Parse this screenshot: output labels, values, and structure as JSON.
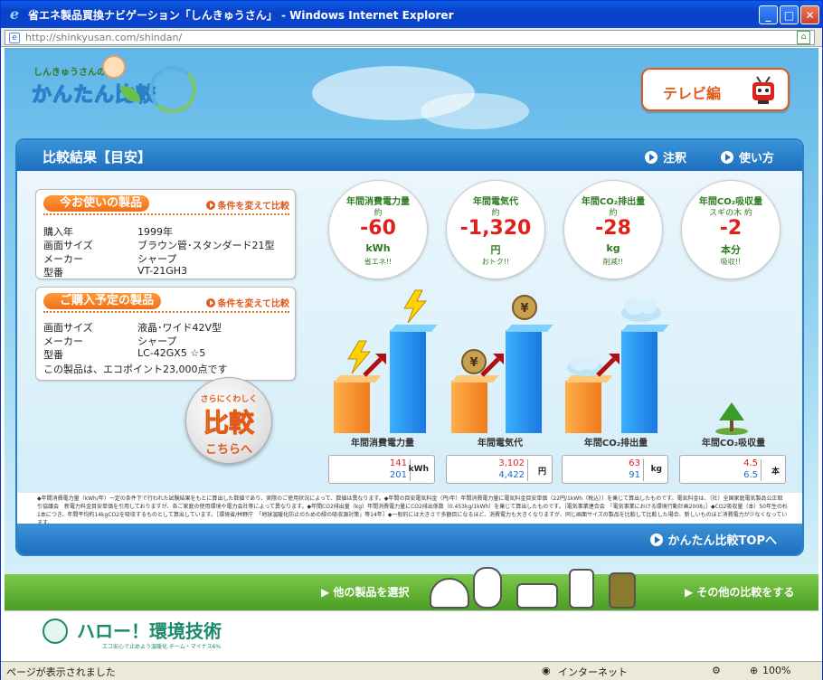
{
  "window": {
    "title": "省エネ製品買換ナビゲーション「しんきゅうさん」 - Windows Internet Explorer",
    "url": "http://shinkyusan.com/shindan/"
  },
  "logo": {
    "small": "しんきゅうさんの",
    "big": "かんたん比較"
  },
  "tv_button": "テレビ編",
  "panel": {
    "title": "比較結果【目安】",
    "links": {
      "notes": "注釈",
      "howto": "使い方"
    },
    "current": {
      "header": "今お使いの製品",
      "change": "条件を変えて比較",
      "rows": [
        {
          "k": "購入年",
          "v": "1999年"
        },
        {
          "k": "画面サイズ",
          "v": "ブラウン管･スタンダード21型"
        },
        {
          "k": "メーカー",
          "v": "シャープ"
        },
        {
          "k": "型番",
          "v": "VT-21GH3"
        }
      ]
    },
    "planned": {
      "header": "ご購入予定の製品",
      "change": "条件を変えて比較",
      "rows": [
        {
          "k": "画面サイズ",
          "v": "液晶･ワイド42V型"
        },
        {
          "k": "メーカー",
          "v": "シャープ"
        },
        {
          "k": "型番",
          "v": "LC-42GX5 ☆5"
        }
      ],
      "eco": "この製品は、エコポイント23,000点です"
    },
    "more": {
      "l1": "さらにくわしく",
      "l2": "比較",
      "l3": "こちらへ"
    },
    "circles": [
      {
        "h": "年間消費電力量",
        "ap": "約",
        "val": "-60",
        "un": "kWh",
        "sub": "省エネ!!"
      },
      {
        "h": "年間電気代",
        "ap": "約",
        "val": "-1,320",
        "un": "円",
        "sub": "おトク!!"
      },
      {
        "h": "年間CO₂排出量",
        "ap": "約",
        "val": "-28",
        "un": "kg",
        "sub": "削減!!"
      },
      {
        "h": "年間CO₂吸収量",
        "ap": "スギの木 約",
        "val": "-2",
        "un": "本分",
        "sub": "吸収!!"
      }
    ],
    "bars": [
      {
        "label": "年間消費電力量",
        "old": 141,
        "new": 201,
        "unit": "kWh"
      },
      {
        "label": "年間電気代",
        "old": "3,102",
        "new": "4,422",
        "unit": "円"
      },
      {
        "label": "年間CO₂排出量",
        "old": 63,
        "new": 91,
        "unit": "kg"
      },
      {
        "label": "年間CO₂吸収量",
        "old": 4.5,
        "new": 6.5,
        "unit": "本"
      }
    ],
    "notes": "◆年間消費電力量（kWh/年）一定の条件下で行われた試験結果をもとに算出した数値であり、実際のご使用状況によって、数値は異なります。◆年間の目安電気料金（円/年）年間消費電力量に電気料金目安単価（22円/1kWh（税込））を乗じて算出したものです。電気料金は、（社）全国家庭電気製品公正取引協議会　新電力料金目安単価を引用しておりますが、各ご家庭の使用環境や電力会社等によって異なります。◆年間CO2排出量（kg）年間消費電力量にCO2排出係数（0.453kg/1kWh）を乗じて算出したものです。［電気事業連合会　「電気事業における環境行動計画2008」］◆CO2吸収量（本）50年生の杉1本につき、年間平均約14kgCO2を吸収するものとして算出しています。［環境省/林野庁　「地球温暖化防止のための緑の吸収源対策」等14年］◆一般的には大きさで多額目になるほど、消費電力も大きくなりますが、同じ画面サイズの製品を比較して比較した場合、新しいものほど消費電力が少なくなっています。",
    "top_link": "かんたん比較TOPへ"
  },
  "green_bar": {
    "left": "他の製品を選択",
    "right": "その他の比較をする"
  },
  "footer": {
    "logo": "ハロー！環境技術",
    "sub": "エコ安心で止めよう温暖化 チーム・マイナス6%"
  },
  "status": {
    "left": "ページが表示されました",
    "zone": "インターネット",
    "zoom": "100%"
  },
  "colors": {
    "accent_blue": "#1e6fbf",
    "orange": "#f0701a",
    "red": "#e0201a",
    "green": "#4a9e24"
  }
}
